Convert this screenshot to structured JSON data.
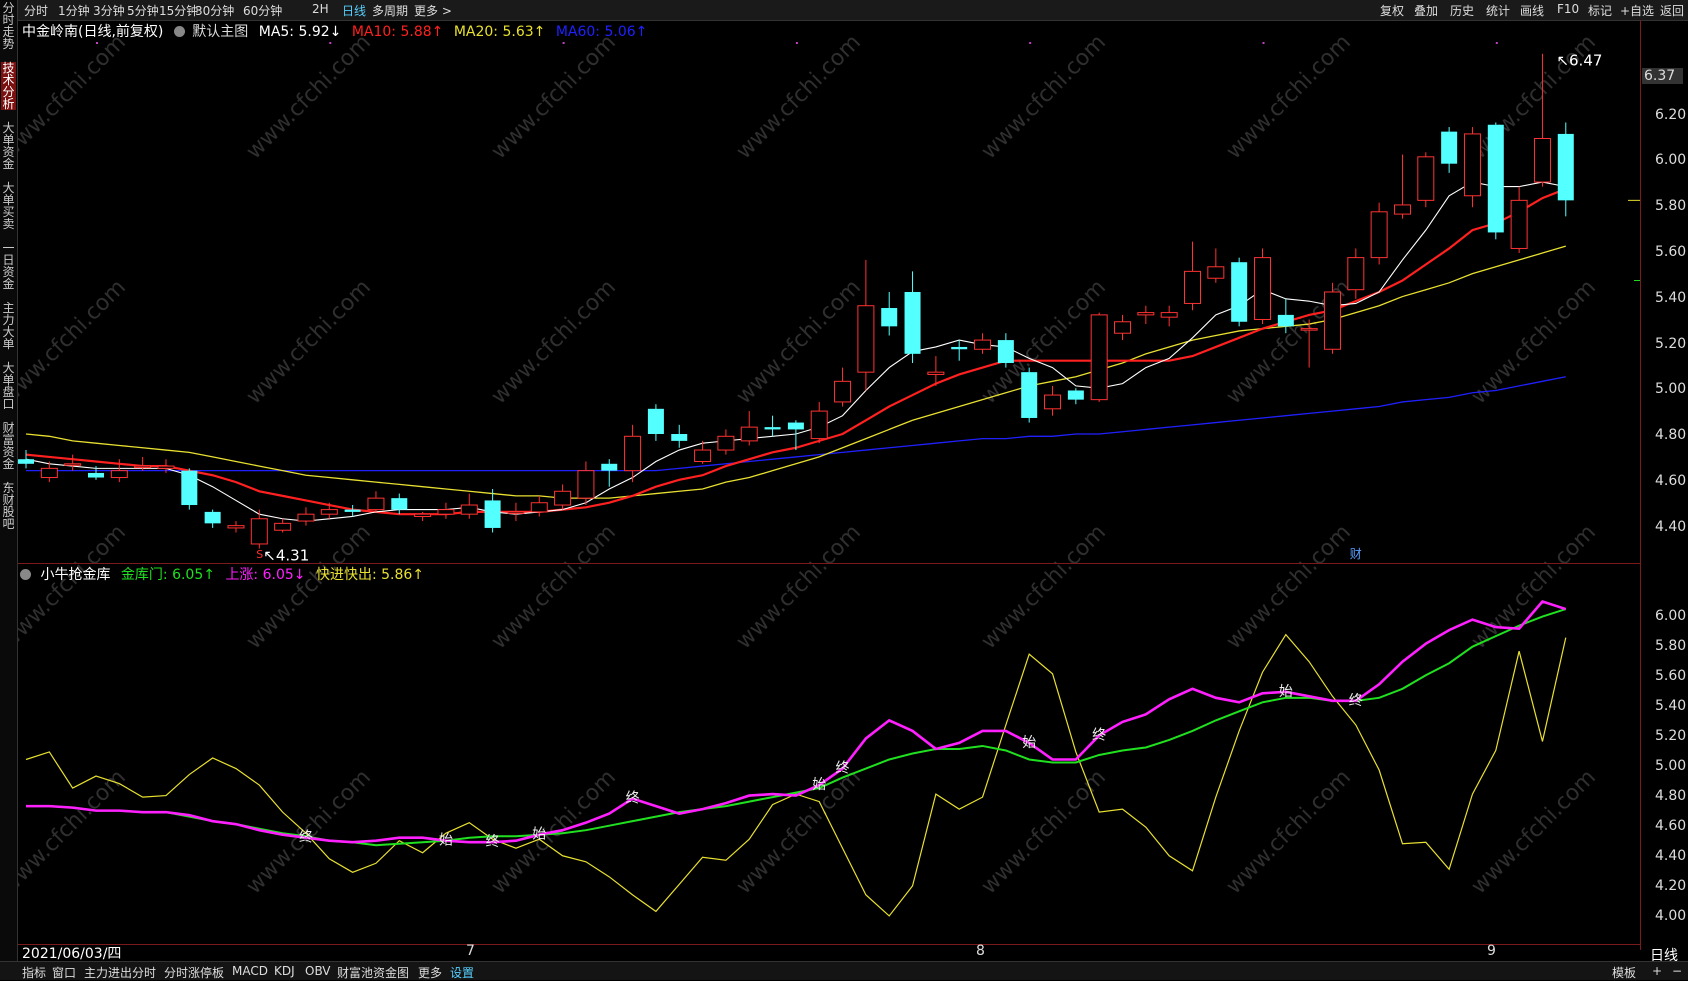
{
  "toolbar": {
    "left": [
      "分时",
      "1分钟",
      "3分钟",
      "5分钟",
      "15分钟",
      "30分钟",
      "60分钟",
      "2H",
      "日线",
      "多周期",
      "更多 >"
    ],
    "active": "日线",
    "right": [
      "复权",
      "叠加",
      "历史",
      "统计",
      "画线",
      "F10",
      "标记",
      "+自选",
      "返回"
    ]
  },
  "left_tabs": [
    "分时走势",
    "技术分析",
    "大单资金",
    "大单买卖",
    "一日资金",
    "主力大单",
    "大单盘口",
    "财富资金",
    "东财股吧"
  ],
  "left_tabs_active": "技术分析",
  "main_header": {
    "name": "中金岭南(日线,前复权)",
    "template": "默认主图",
    "ma5": "MA5: 5.92↓",
    "ma10": "MA10: 5.88↑",
    "ma20": "MA20: 5.63↑",
    "ma60": "MA60: 5.06↑"
  },
  "sub_header": {
    "name": "小牛抢金库",
    "line1": "金库门: 6.05↑",
    "line2": "上涨: 6.05↓",
    "line3": "快进快出: 5.86↑"
  },
  "price_axis": [
    "6.37",
    "6.20",
    "6.00",
    "5.80",
    "5.60",
    "5.40",
    "5.20",
    "5.00",
    "4.80",
    "4.60",
    "4.40"
  ],
  "indicator_axis": [
    "6.00",
    "5.80",
    "5.60",
    "5.40",
    "5.20",
    "5.00",
    "4.80",
    "4.60",
    "4.40",
    "4.20",
    "4.00"
  ],
  "annotations": {
    "high": "6.47",
    "low": "4.31",
    "low_marker": "S",
    "fin_marker": "财"
  },
  "signal_labels": [
    "终",
    "始",
    "终",
    "始",
    "终",
    "始",
    "终",
    "始",
    "终",
    "始",
    "终"
  ],
  "watermark": "www.cfchi.com",
  "date_axis": {
    "start": "2021/06/03/四",
    "labels": [
      "7",
      "8",
      "9"
    ],
    "period": "日线"
  },
  "bottom_tabs": [
    "指标",
    "窗口",
    "主力进出分时",
    "分时涨停板",
    "MACD",
    "KDJ",
    "OBV",
    "财富池资金图",
    "更多",
    "设置"
  ],
  "bottom_active": "设置",
  "bottom_right": [
    "模板",
    "+",
    "−"
  ],
  "colors": {
    "up": "#ff3232",
    "down": "#54ffff",
    "ma5": "#ffffff",
    "ma10": "#ff2020",
    "ma20": "#e8e030",
    "ma60": "#2020ff",
    "gate": "#20e020",
    "rise": "#ff20ff",
    "fast": "#e8e030"
  },
  "chart_data": [
    {
      "type": "candlestick",
      "title": "中金岭南(日线,前复权)",
      "candles": [
        [
          4.7,
          4.68,
          4.74,
          4.66
        ],
        [
          4.62,
          4.66,
          4.69,
          4.6
        ],
        [
          4.68,
          4.68,
          4.72,
          4.65
        ],
        [
          4.64,
          4.62,
          4.67,
          4.61
        ],
        [
          4.62,
          4.65,
          4.7,
          4.6
        ],
        [
          4.67,
          4.67,
          4.71,
          4.65
        ],
        [
          4.66,
          4.67,
          4.7,
          4.64
        ],
        [
          4.65,
          4.5,
          4.66,
          4.48
        ],
        [
          4.47,
          4.42,
          4.48,
          4.4
        ],
        [
          4.4,
          4.41,
          4.43,
          4.38
        ],
        [
          4.33,
          4.44,
          4.48,
          4.31
        ],
        [
          4.39,
          4.42,
          4.44,
          4.38
        ],
        [
          4.43,
          4.46,
          4.49,
          4.41
        ],
        [
          4.46,
          4.48,
          4.51,
          4.44
        ],
        [
          4.48,
          4.47,
          4.5,
          4.45
        ],
        [
          4.48,
          4.53,
          4.56,
          4.47
        ],
        [
          4.53,
          4.48,
          4.55,
          4.46
        ],
        [
          4.45,
          4.46,
          4.47,
          4.43
        ],
        [
          4.46,
          4.48,
          4.51,
          4.44
        ],
        [
          4.46,
          4.5,
          4.55,
          4.44
        ],
        [
          4.52,
          4.4,
          4.57,
          4.38
        ],
        [
          4.47,
          4.47,
          4.51,
          4.43
        ],
        [
          4.47,
          4.51,
          4.54,
          4.45
        ],
        [
          4.5,
          4.56,
          4.59,
          4.48
        ],
        [
          4.53,
          4.65,
          4.69,
          4.5
        ],
        [
          4.68,
          4.65,
          4.7,
          4.58
        ],
        [
          4.65,
          4.8,
          4.85,
          4.6
        ],
        [
          4.92,
          4.81,
          4.94,
          4.78
        ],
        [
          4.81,
          4.78,
          4.85,
          4.75
        ],
        [
          4.69,
          4.74,
          4.78,
          4.68
        ],
        [
          4.74,
          4.8,
          4.83,
          4.72
        ],
        [
          4.78,
          4.84,
          4.91,
          4.76
        ],
        [
          4.84,
          4.83,
          4.89,
          4.8
        ],
        [
          4.86,
          4.83,
          4.87,
          4.74
        ],
        [
          4.79,
          4.91,
          4.95,
          4.77
        ],
        [
          4.95,
          5.04,
          5.1,
          4.93
        ],
        [
          5.08,
          5.37,
          5.57,
          5.0
        ],
        [
          5.36,
          5.28,
          5.43,
          5.24
        ],
        [
          5.43,
          5.16,
          5.52,
          5.12
        ],
        [
          5.07,
          5.08,
          5.15,
          5.02
        ],
        [
          5.19,
          5.18,
          5.22,
          5.13
        ],
        [
          5.18,
          5.22,
          5.25,
          5.16
        ],
        [
          5.22,
          5.12,
          5.25,
          5.1
        ],
        [
          5.08,
          4.88,
          5.1,
          4.86
        ],
        [
          4.92,
          4.98,
          5.02,
          4.89
        ],
        [
          5.0,
          4.96,
          5.01,
          4.94
        ],
        [
          4.96,
          5.33,
          5.34,
          4.95
        ],
        [
          5.25,
          5.3,
          5.33,
          5.22
        ],
        [
          5.33,
          5.34,
          5.37,
          5.29
        ],
        [
          5.32,
          5.34,
          5.37,
          5.28
        ],
        [
          5.38,
          5.52,
          5.65,
          5.35
        ],
        [
          5.49,
          5.54,
          5.62,
          5.47
        ],
        [
          5.56,
          5.3,
          5.58,
          5.28
        ],
        [
          5.31,
          5.58,
          5.62,
          5.29
        ],
        [
          5.33,
          5.28,
          5.4,
          5.25
        ],
        [
          5.27,
          5.27,
          5.31,
          5.1
        ],
        [
          5.18,
          5.43,
          5.47,
          5.16
        ],
        [
          5.44,
          5.58,
          5.62,
          5.4
        ],
        [
          5.58,
          5.78,
          5.82,
          5.55
        ],
        [
          5.77,
          5.81,
          6.03,
          5.75
        ],
        [
          5.83,
          6.02,
          6.04,
          5.8
        ],
        [
          6.13,
          5.99,
          6.15,
          5.95
        ],
        [
          5.85,
          6.12,
          6.15,
          5.8
        ],
        [
          6.16,
          5.69,
          6.17,
          5.66
        ],
        [
          5.62,
          5.83,
          5.89,
          5.6
        ],
        [
          5.91,
          6.1,
          6.47,
          5.89
        ],
        [
          6.12,
          5.83,
          6.17,
          5.76
        ]
      ],
      "ma5": [
        4.7,
        4.68,
        4.67,
        4.66,
        4.66,
        4.66,
        4.66,
        4.63,
        4.58,
        4.52,
        4.46,
        4.44,
        4.43,
        4.44,
        4.45,
        4.47,
        4.48,
        4.48,
        4.48,
        4.49,
        4.47,
        4.46,
        4.47,
        4.48,
        4.51,
        4.57,
        4.62,
        4.69,
        4.74,
        4.77,
        4.78,
        4.79,
        4.8,
        4.81,
        4.84,
        4.89,
        5.0,
        5.1,
        5.17,
        5.19,
        5.22,
        5.2,
        5.19,
        5.14,
        5.1,
        5.02,
        5.01,
        5.03,
        5.1,
        5.14,
        5.23,
        5.33,
        5.37,
        5.44,
        5.4,
        5.39,
        5.37,
        5.38,
        5.43,
        5.57,
        5.7,
        5.85,
        5.91,
        5.89,
        5.89,
        5.91,
        5.89
      ],
      "ma10": [
        4.72,
        4.71,
        4.7,
        4.69,
        4.68,
        4.67,
        4.67,
        4.65,
        4.63,
        4.6,
        4.56,
        4.54,
        4.52,
        4.5,
        4.48,
        4.47,
        4.46,
        4.46,
        4.46,
        4.47,
        4.47,
        4.47,
        4.47,
        4.48,
        4.49,
        4.51,
        4.54,
        4.58,
        4.61,
        4.63,
        4.67,
        4.7,
        4.73,
        4.75,
        4.78,
        4.81,
        4.87,
        4.93,
        4.98,
        5.03,
        5.07,
        5.1,
        5.13,
        5.13,
        5.13,
        5.13,
        5.13,
        5.13,
        5.13,
        5.13,
        5.15,
        5.19,
        5.23,
        5.27,
        5.3,
        5.33,
        5.35,
        5.39,
        5.43,
        5.48,
        5.55,
        5.62,
        5.7,
        5.73,
        5.78,
        5.84,
        5.88
      ],
      "ma20": [
        4.81,
        4.8,
        4.78,
        4.77,
        4.76,
        4.75,
        4.74,
        4.73,
        4.71,
        4.69,
        4.67,
        4.65,
        4.63,
        4.62,
        4.61,
        4.6,
        4.59,
        4.58,
        4.57,
        4.56,
        4.55,
        4.54,
        4.54,
        4.53,
        4.53,
        4.53,
        4.54,
        4.55,
        4.56,
        4.57,
        4.6,
        4.62,
        4.65,
        4.68,
        4.71,
        4.75,
        4.79,
        4.83,
        4.87,
        4.9,
        4.93,
        4.96,
        4.99,
        5.02,
        5.04,
        5.06,
        5.09,
        5.12,
        5.16,
        5.19,
        5.22,
        5.24,
        5.26,
        5.27,
        5.28,
        5.29,
        5.31,
        5.34,
        5.37,
        5.41,
        5.44,
        5.47,
        5.51,
        5.54,
        5.57,
        5.6,
        5.63
      ],
      "ma60": [
        4.65,
        4.65,
        4.65,
        4.65,
        4.65,
        4.65,
        4.65,
        4.65,
        4.65,
        4.65,
        4.65,
        4.65,
        4.65,
        4.65,
        4.65,
        4.65,
        4.65,
        4.65,
        4.65,
        4.65,
        4.65,
        4.65,
        4.65,
        4.65,
        4.65,
        4.65,
        4.65,
        4.65,
        4.66,
        4.67,
        4.68,
        4.69,
        4.7,
        4.71,
        4.72,
        4.73,
        4.74,
        4.75,
        4.76,
        4.77,
        4.78,
        4.79,
        4.79,
        4.8,
        4.8,
        4.81,
        4.81,
        4.82,
        4.83,
        4.84,
        4.85,
        4.86,
        4.87,
        4.88,
        4.89,
        4.9,
        4.91,
        4.92,
        4.93,
        4.95,
        4.96,
        4.97,
        4.99,
        5.0,
        5.02,
        5.04,
        5.06
      ],
      "ylim": [
        4.26,
        6.53
      ]
    },
    {
      "type": "line",
      "title": "小牛抢金库",
      "series": [
        {
          "name": "金库门",
          "values": [
            4.74,
            4.74,
            4.73,
            4.71,
            4.71,
            4.7,
            4.7,
            4.67,
            4.64,
            4.62,
            4.59,
            4.56,
            4.54,
            4.51,
            4.5,
            4.48,
            4.49,
            4.5,
            4.51,
            4.53,
            4.54,
            4.54,
            4.55,
            4.56,
            4.58,
            4.61,
            4.64,
            4.67,
            4.7,
            4.72,
            4.74,
            4.77,
            4.8,
            4.83,
            4.86,
            4.93,
            4.99,
            5.05,
            5.09,
            5.12,
            5.12,
            5.14,
            5.11,
            5.05,
            5.03,
            5.03,
            5.08,
            5.11,
            5.13,
            5.18,
            5.24,
            5.31,
            5.37,
            5.43,
            5.46,
            5.46,
            5.44,
            5.44,
            5.46,
            5.52,
            5.61,
            5.69,
            5.8,
            5.87,
            5.94,
            6.0,
            6.05
          ]
        },
        {
          "name": "上涨",
          "values": [
            4.74,
            4.74,
            4.73,
            4.71,
            4.71,
            4.7,
            4.7,
            4.68,
            4.64,
            4.62,
            4.58,
            4.55,
            4.53,
            4.51,
            4.5,
            4.51,
            4.53,
            4.53,
            4.51,
            4.5,
            4.5,
            4.51,
            4.55,
            4.58,
            4.63,
            4.69,
            4.79,
            4.74,
            4.69,
            4.72,
            4.76,
            4.81,
            4.82,
            4.81,
            4.88,
            4.99,
            5.19,
            5.31,
            5.24,
            5.12,
            5.16,
            5.24,
            5.24,
            5.16,
            5.05,
            5.05,
            5.21,
            5.3,
            5.35,
            5.45,
            5.52,
            5.46,
            5.43,
            5.49,
            5.5,
            5.47,
            5.44,
            5.44,
            5.55,
            5.7,
            5.82,
            5.91,
            5.98,
            5.93,
            5.92,
            6.1,
            6.05
          ]
        },
        {
          "name": "快进快出",
          "values": [
            5.05,
            5.1,
            4.86,
            4.94,
            4.89,
            4.8,
            4.81,
            4.95,
            5.06,
            4.99,
            4.88,
            4.7,
            4.56,
            4.39,
            4.3,
            4.36,
            4.51,
            4.43,
            4.56,
            4.63,
            4.52,
            4.46,
            4.52,
            4.41,
            4.37,
            4.27,
            4.15,
            4.04,
            4.22,
            4.4,
            4.38,
            4.52,
            4.75,
            4.82,
            4.77,
            4.46,
            4.15,
            4.01,
            4.21,
            4.82,
            4.72,
            4.8,
            5.28,
            5.75,
            5.62,
            5.1,
            4.7,
            4.72,
            4.6,
            4.41,
            4.31,
            4.8,
            5.24,
            5.63,
            5.88,
            5.7,
            5.47,
            5.28,
            4.98,
            4.49,
            4.5,
            4.32,
            4.82,
            5.11,
            5.77,
            5.17,
            5.86
          ]
        }
      ],
      "ylim": [
        3.85,
        6.21
      ]
    }
  ]
}
